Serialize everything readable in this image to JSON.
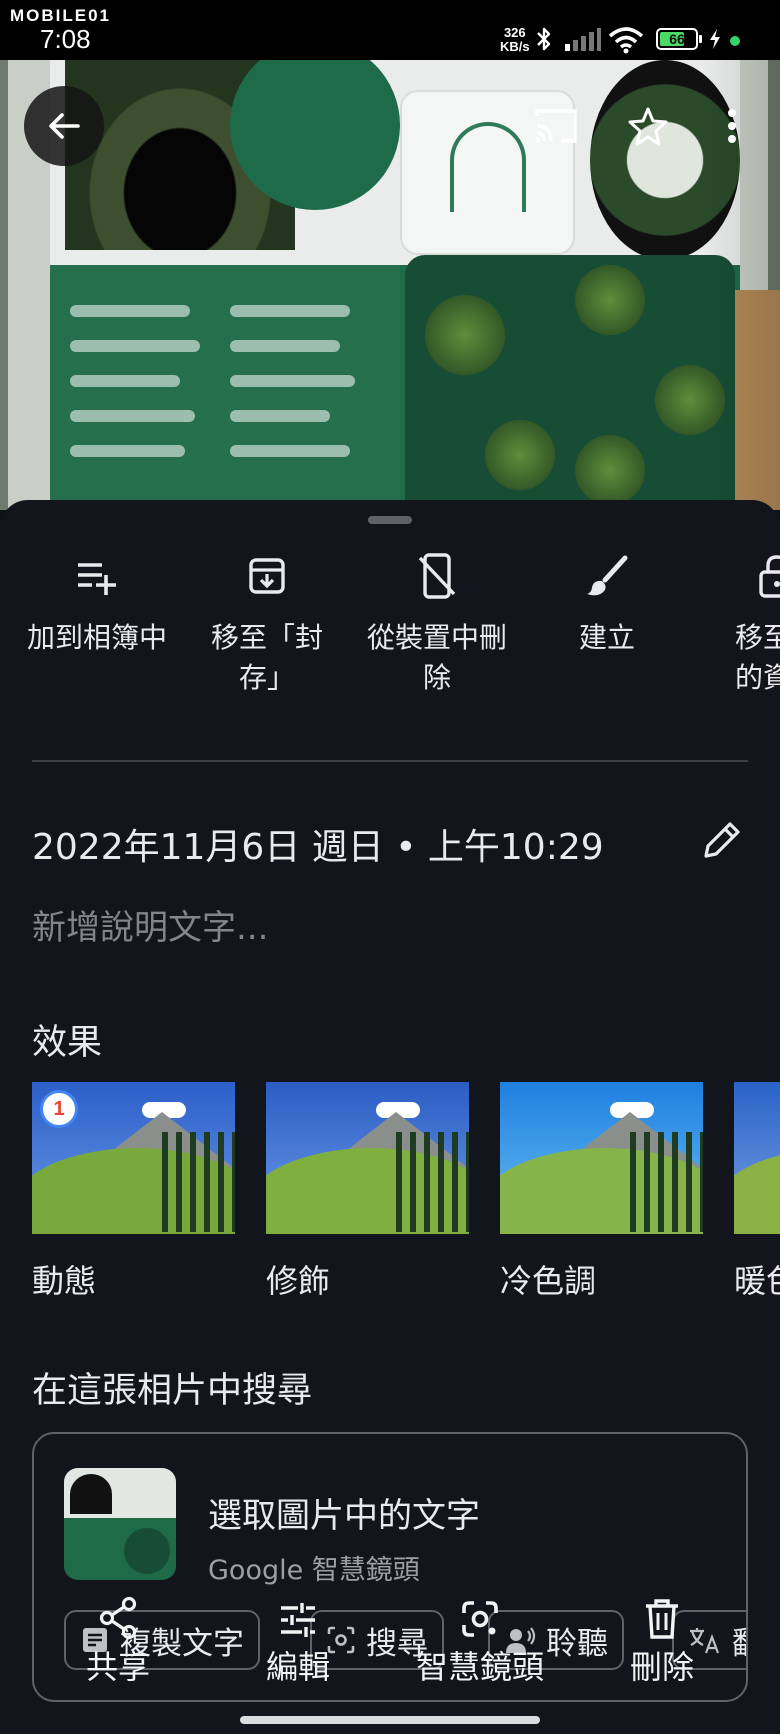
{
  "status_bar": {
    "brand": "MOBILE01",
    "time": "7:08",
    "net_speed_value": "326",
    "net_speed_unit": "KB/s",
    "battery": "66"
  },
  "sheet_actions": [
    {
      "label": "加到相簿中",
      "icon": "playlist-add-icon"
    },
    {
      "label": "移至「封\n存」",
      "icon": "archive-icon"
    },
    {
      "label": "從裝置中刪\n除",
      "icon": "mobile-off-icon"
    },
    {
      "label": "建立",
      "icon": "brush-icon"
    },
    {
      "label": "移至已\n的資料",
      "icon": "lock-icon"
    }
  ],
  "details": {
    "datetime": "2022年11月6日 週日 • 上午10:29",
    "caption_placeholder": "新增說明文字..."
  },
  "effects": {
    "title": "效果",
    "items": [
      {
        "label": "動態"
      },
      {
        "label": "修飾"
      },
      {
        "label": "冷色調"
      },
      {
        "label": "暖色"
      }
    ]
  },
  "search_in_photo": {
    "title": "在這張相片中搜尋",
    "card_title": "選取圖片中的文字",
    "card_subtitle": "Google 智慧鏡頭",
    "chips": [
      {
        "label": "複製文字",
        "icon": "copy-text-icon"
      },
      {
        "label": "搜尋",
        "icon": "lens-search-icon"
      },
      {
        "label": "聆聽",
        "icon": "listen-icon"
      },
      {
        "label": "翻",
        "icon": "translate-icon"
      }
    ]
  },
  "bottom_bar": [
    {
      "label": "共享",
      "icon": "share-icon"
    },
    {
      "label": "編輯",
      "icon": "edit-tune-icon"
    },
    {
      "label": "智慧鏡頭",
      "icon": "google-lens-icon"
    },
    {
      "label": "刪除",
      "icon": "trash-icon"
    }
  ],
  "colors": {
    "sheet_bg": "#12161c",
    "text_primary": "#e8eaed",
    "text_secondary": "#9aa0a6",
    "outline": "#5f6368"
  }
}
